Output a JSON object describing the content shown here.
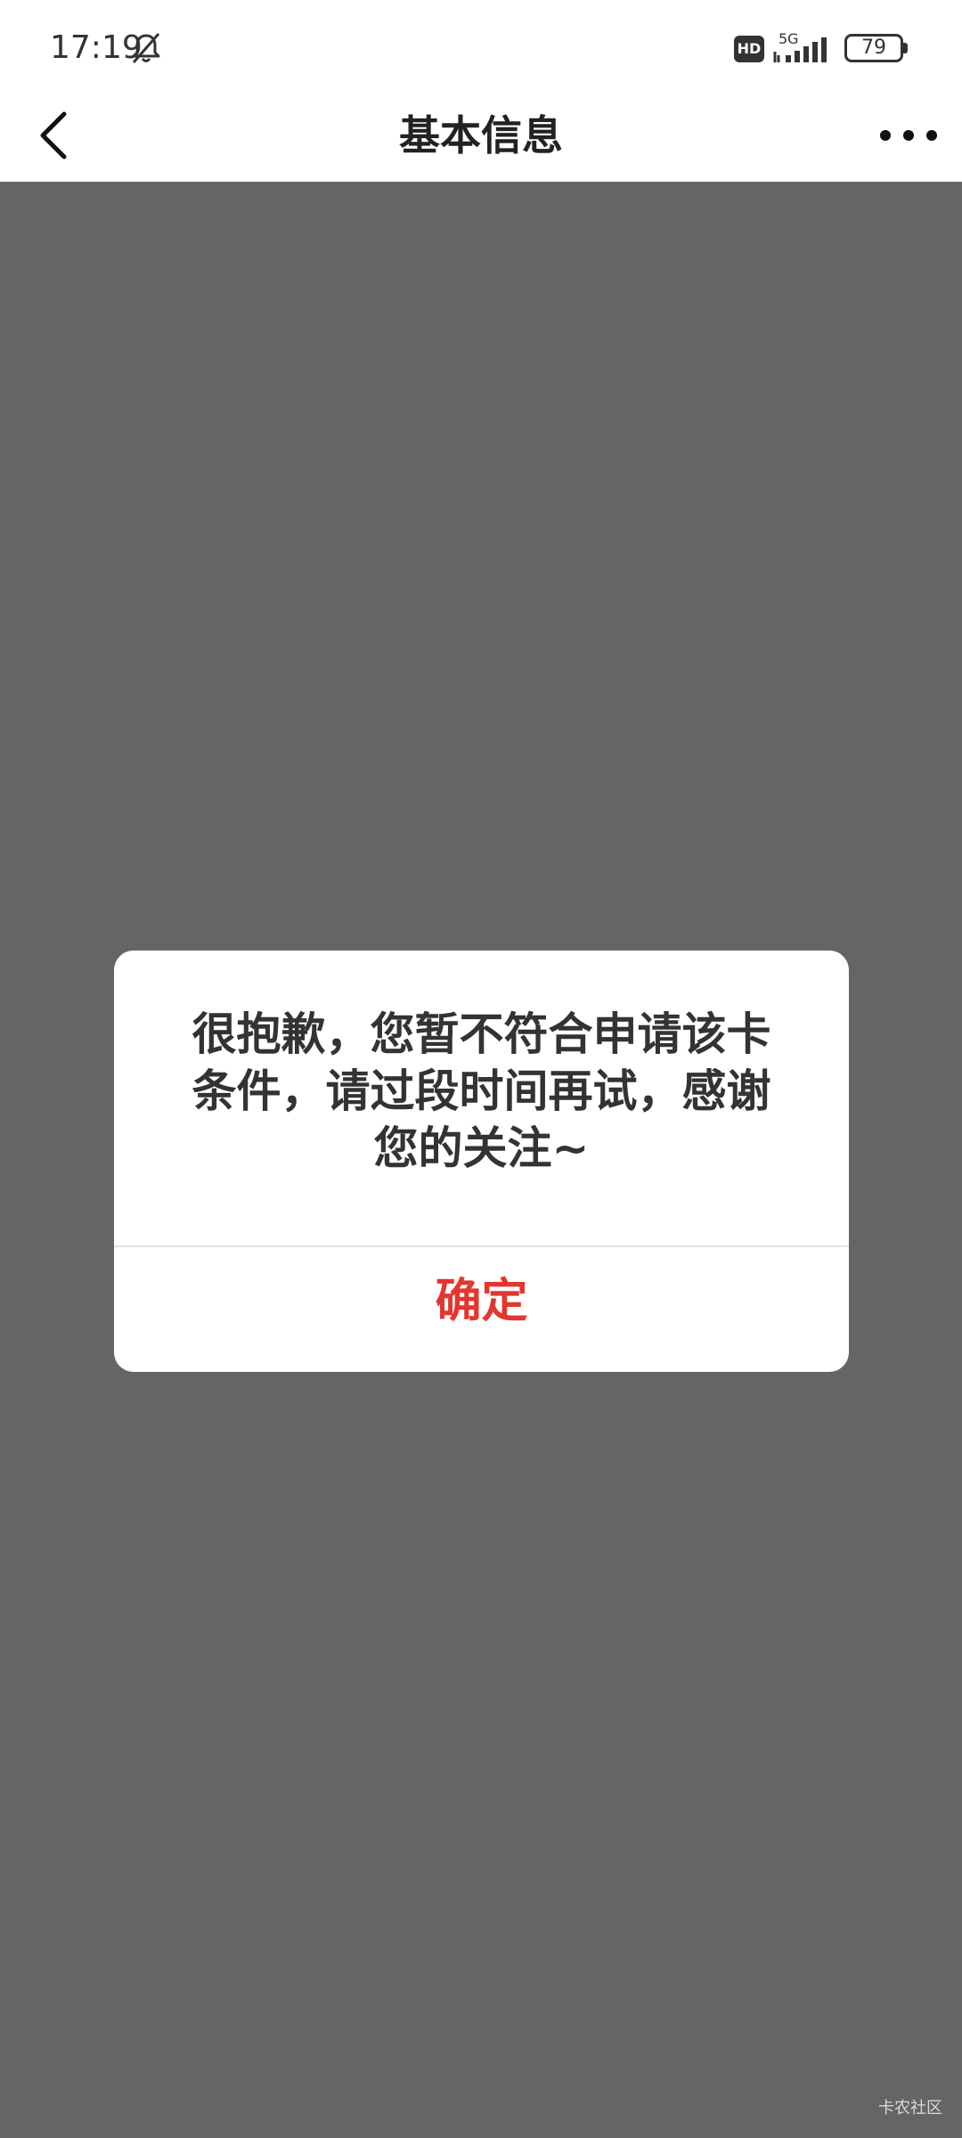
{
  "status_bar": {
    "time": "17:19",
    "hd_badge": "HD",
    "network": "5G",
    "battery": "79"
  },
  "nav": {
    "title": "基本信息"
  },
  "dialog": {
    "message": "很抱歉，您暂不符合申请该卡条件，请过段时间再试，感谢您的关注~",
    "confirm_label": "确定",
    "confirm_color": "#e2362f"
  },
  "watermark": "卡农社区",
  "colors": {
    "overlay": "#656565",
    "background": "#ffffff"
  }
}
